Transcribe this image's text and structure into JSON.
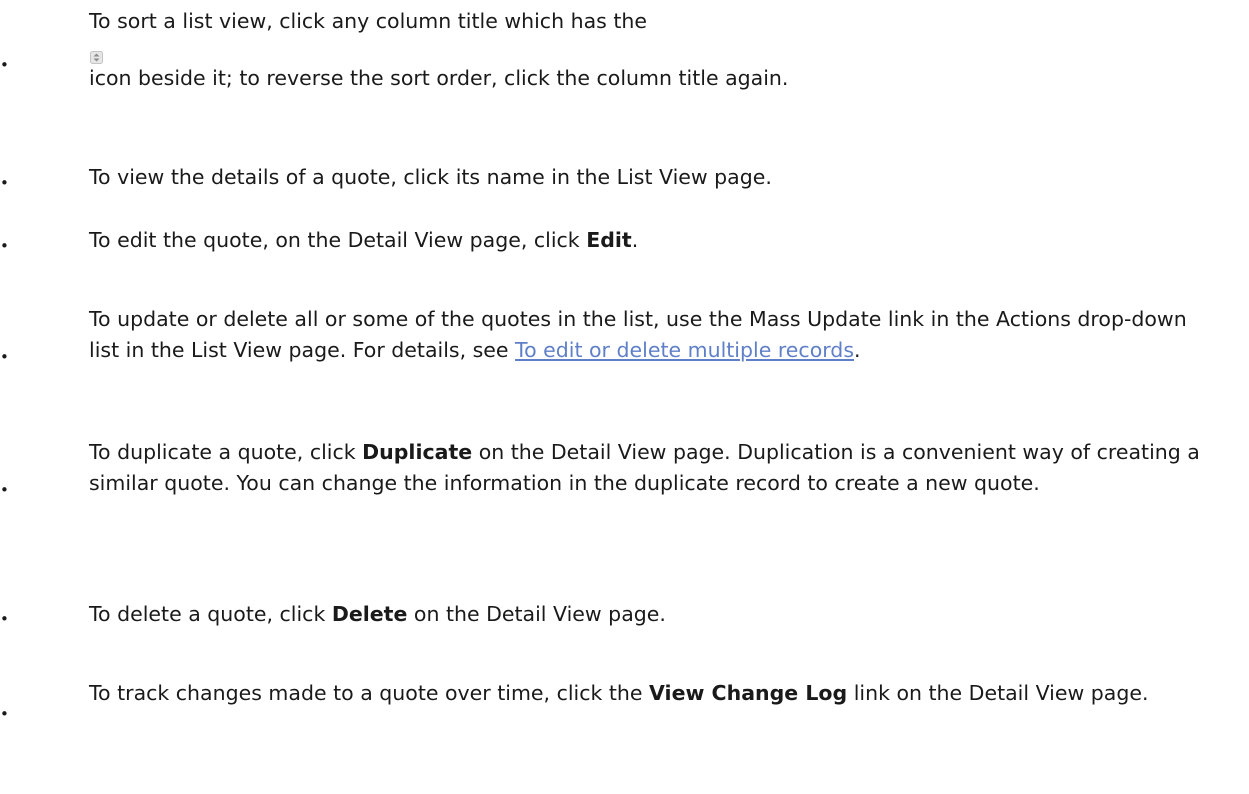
{
  "items": [
    {
      "line1": "To sort a list view, click any column title which has the",
      "icon": "sort-arrows-icon",
      "line2": "icon beside it; to reverse the sort order, click the column title again."
    },
    {
      "text": "To view the details of a quote, click its name in the List View page."
    },
    {
      "pre": "To edit the quote, on the Detail View page, click ",
      "bold": "Edit",
      "post": "."
    },
    {
      "pre": "To update or delete all or some of the quotes in the list, use the Mass Update link in the Actions drop-down list in the List View page. For details, see ",
      "link": "To edit or delete multiple records",
      "post": "."
    },
    {
      "pre": "To duplicate a quote, click ",
      "bold": "Duplicate",
      "post": " on the Detail View page. Duplication is a convenient way of creating a similar quote. You can change the information in the duplicate record to create a new quote."
    },
    {
      "pre": "To delete a quote, click ",
      "bold": "Delete",
      "post": " on the Detail View page."
    },
    {
      "pre": "To track changes made to a quote over time, click the ",
      "bold": "View Change Log",
      "post": " link on the Detail View page."
    }
  ],
  "colors": {
    "text": "#1a1a1a",
    "link": "#5f80c8"
  }
}
